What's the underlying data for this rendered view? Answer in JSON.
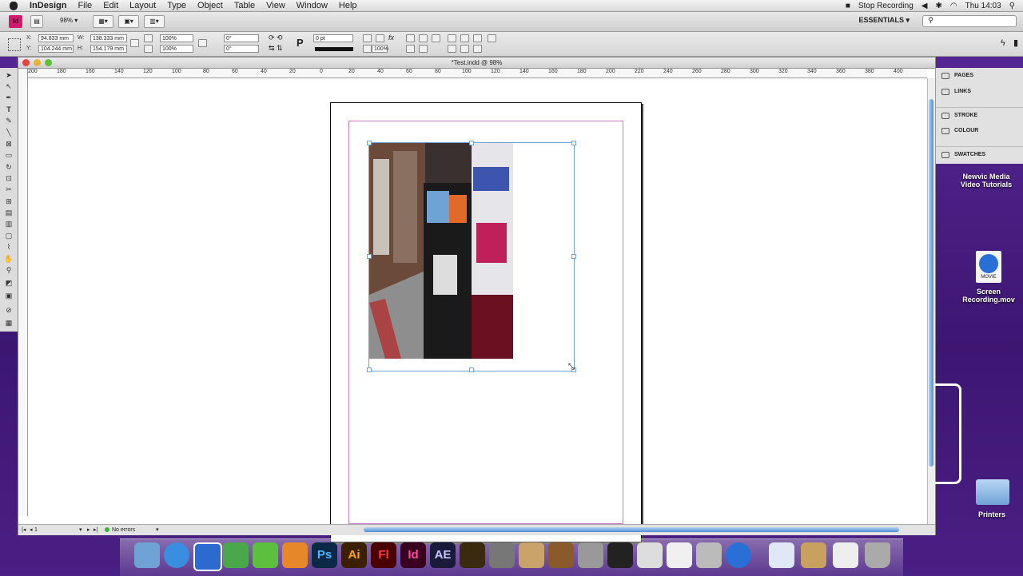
{
  "menubar": {
    "app_name": "InDesign",
    "menus": [
      "File",
      "Edit",
      "Layout",
      "Type",
      "Object",
      "Table",
      "View",
      "Window",
      "Help"
    ],
    "stop_recording": "Stop Recording",
    "clock": "Thu 14:03"
  },
  "appbar": {
    "logo": "Id",
    "zoom": "98%",
    "workspace": "ESSENTIALS ▾"
  },
  "control": {
    "x_label": "X:",
    "x_value": "94.833 mm",
    "y_label": "Y:",
    "y_value": "104.244 mm",
    "w_label": "W:",
    "w_value": "138.333 mm",
    "h_label": "H:",
    "h_value": "154.179 mm",
    "scale_x": "100%",
    "scale_y": "100%",
    "angle_1": "0°",
    "angle_2": "0°",
    "stroke_weight": "0 pt",
    "opacity": "100%"
  },
  "document": {
    "title": "*Test.indd @ 98%",
    "ruler_ticks": [
      "200",
      "180",
      "160",
      "140",
      "120",
      "100",
      "80",
      "60",
      "40",
      "20",
      "0",
      "20",
      "40",
      "60",
      "80",
      "100",
      "120",
      "140",
      "160",
      "180",
      "200",
      "220",
      "240",
      "260",
      "280",
      "300",
      "320",
      "340",
      "360",
      "380",
      "400"
    ],
    "page_number": "1",
    "errors": "No errors"
  },
  "panels": {
    "items": [
      "PAGES",
      "LINKS",
      "STROKE",
      "COLOUR",
      "SWATCHES"
    ]
  },
  "desktop": {
    "folder1": "Newvic Media\nVideo Tutorials",
    "movie_badge": "MOVIE",
    "movie": "Screen\nRecording.mov",
    "printers": "Printers"
  },
  "dock": {
    "apps": [
      "Finder",
      "Safari",
      "Mail",
      "Dreamweaver",
      "Flash Catalyst",
      "Fireworks",
      "Ps",
      "Ai",
      "Fl",
      "Id",
      "AE",
      "Soundbooth",
      "iMovie Star",
      "Preview",
      "GarageBand",
      "Final Cut",
      "Clapper",
      "DVD Player",
      "TextEdit",
      "Image Capture",
      "QuickTime",
      "Documents",
      "Downloads",
      "Pictures",
      "Trash"
    ]
  },
  "colors": {
    "accent": "#6fa3d6",
    "margin_guide": "#c77bc7",
    "desktop": "#4b1f86",
    "indesign_logo": "#d1196f"
  }
}
